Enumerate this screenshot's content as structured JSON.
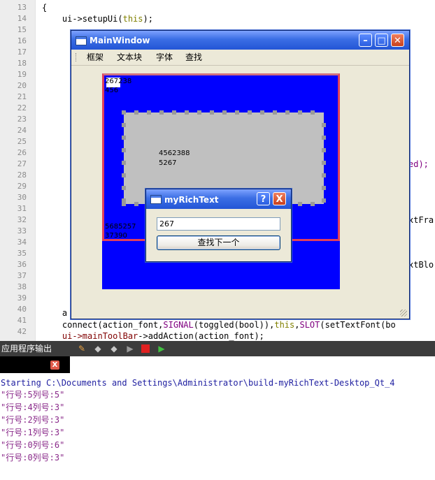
{
  "editor": {
    "line_numbers": [
      "13",
      "14",
      "15",
      "16",
      "17",
      "18",
      "19",
      "20",
      "21",
      "22",
      "23",
      "24",
      "25",
      "26",
      "27",
      "28",
      "29",
      "30",
      "31",
      "32",
      "33",
      "34",
      "35",
      "36",
      "37",
      "38",
      "39",
      "40",
      "41",
      "42"
    ],
    "lines": {
      "l13": "{",
      "l14_a": "    ui->setupUi(",
      "l14_b": "this",
      "l14_c": ");",
      "l40_a": "    a",
      "l41_a": "    connect(action_font,",
      "l41_b": "SIGNAL",
      "l41_c": "(toggled(bool)),",
      "l41_d": "this",
      "l41_e": ",",
      "l41_f": "SLOT",
      "l41_g": "(setTextFont(bo",
      "l42_a": "    ",
      "l42_b": "ui->mainToolBar",
      "l42_c": "->addAction(action_font);",
      "r28": "ed);",
      "r32": "xtFra",
      "r36": "xtBlo"
    }
  },
  "main_window": {
    "title": "MainWindow",
    "menu": [
      "框架",
      "文本块",
      "字体",
      "查找"
    ],
    "text_top_1": "267",
    "text_top_1b": "238",
    "text_top_2": "456",
    "text_center_1": "4562388",
    "text_center_2": "5267",
    "text_bottom_1": "5685257",
    "text_bottom_2": "37390"
  },
  "dialog": {
    "title": "myRichText",
    "help": "?",
    "close": "X",
    "input_value": "267",
    "button_label": "查找下一个"
  },
  "output": {
    "title": "应用程序输出",
    "close": "X",
    "lines": [
      "Starting C:\\Documents and Settings\\Administrator\\build-myRichText-Desktop_Qt_4",
      "\"行号:5列号:5\"",
      "\"行号:4列号:3\"",
      "\"行号:2列号:3\"",
      "\"行号:1列号:3\"",
      "\"行号:0列号:6\"",
      "\"行号:0列号:3\""
    ]
  },
  "colors": {
    "textedit_bg": "#0000ff",
    "frame_border": "#e0405c",
    "frame_inner": "#c0c0c0",
    "titlebar": "#2355d6"
  }
}
